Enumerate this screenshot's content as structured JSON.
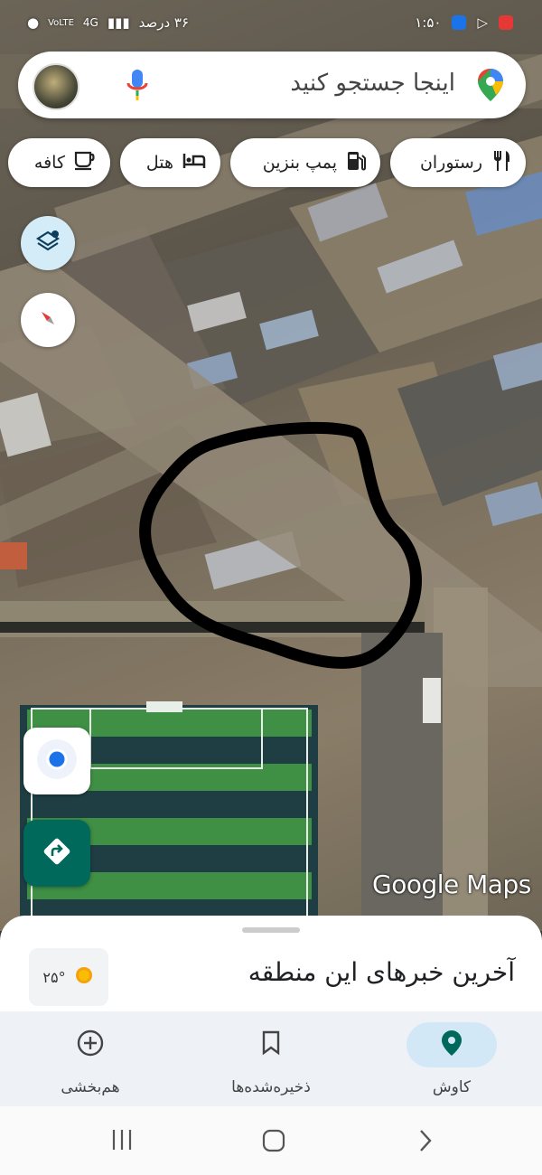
{
  "status_bar": {
    "time": "۱:۵۰",
    "battery": "۳۶ درصد",
    "network": "4G",
    "lte": "VoLTE"
  },
  "search": {
    "placeholder": "اینجا جستجو کنید"
  },
  "chips": [
    {
      "label": "رستوران",
      "icon": "restaurant-icon"
    },
    {
      "label": "پمپ بنزین",
      "icon": "gas-station-icon"
    },
    {
      "label": "هتل",
      "icon": "hotel-icon"
    },
    {
      "label": "کافه",
      "icon": "cafe-icon"
    }
  ],
  "map": {
    "brand": "Google Maps",
    "colors": {
      "turf_light": "#3f8f45",
      "turf_dark": "#1f3e43",
      "annotation": "#000000"
    }
  },
  "sheet": {
    "title": "آخرین خبرهای این منطقه",
    "temperature": "۲۵°"
  },
  "nav": {
    "explore": "کاوش",
    "saved": "ذخیره‌شده‌ها",
    "contribute": "هم‌بخشی"
  },
  "colors": {
    "accent": "#00695c",
    "nav_active_bg": "#d3e8f7",
    "location_blue": "#1a73e8"
  }
}
